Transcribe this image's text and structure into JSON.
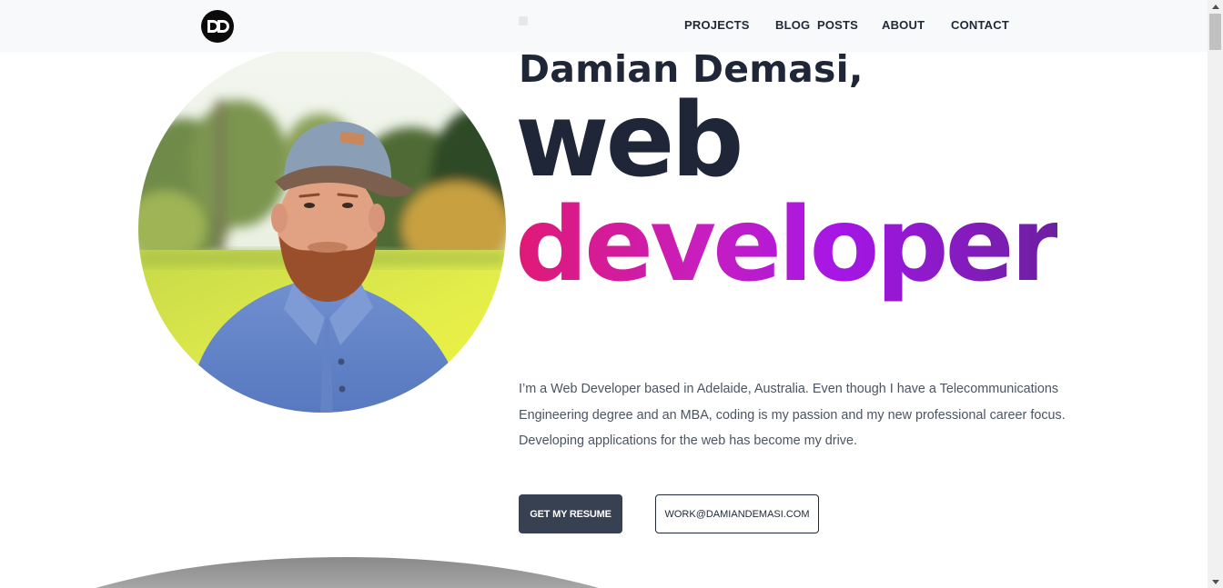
{
  "header": {
    "logo_icon": "dd-monogram-logo",
    "nav": {
      "projects": "PROJECTS",
      "blog": "BLOG  POSTS",
      "about": "ABOUT",
      "contact": "CONTACT"
    }
  },
  "hero": {
    "name": "Damian Demasi,",
    "role_line1": "web",
    "role_line2": "developer",
    "intro": "I’m a Web Developer based in Adelaide, Australia. Even though I have a Telecommunications Engineering degree and an MBA, coding is my passion and my new professional career focus. Developing applications for the web has become my drive.",
    "resume_button": "GET MY RESUME",
    "email_button": "WORK@DAMIANDEMASI.COM"
  },
  "colors": {
    "heading": "#1e2637",
    "gradient_start": "#e01974",
    "gradient_mid": "#a516e6",
    "gradient_end": "#6c1fa0",
    "button_dark": "#374151",
    "header_bg": "#f8f9fb"
  }
}
